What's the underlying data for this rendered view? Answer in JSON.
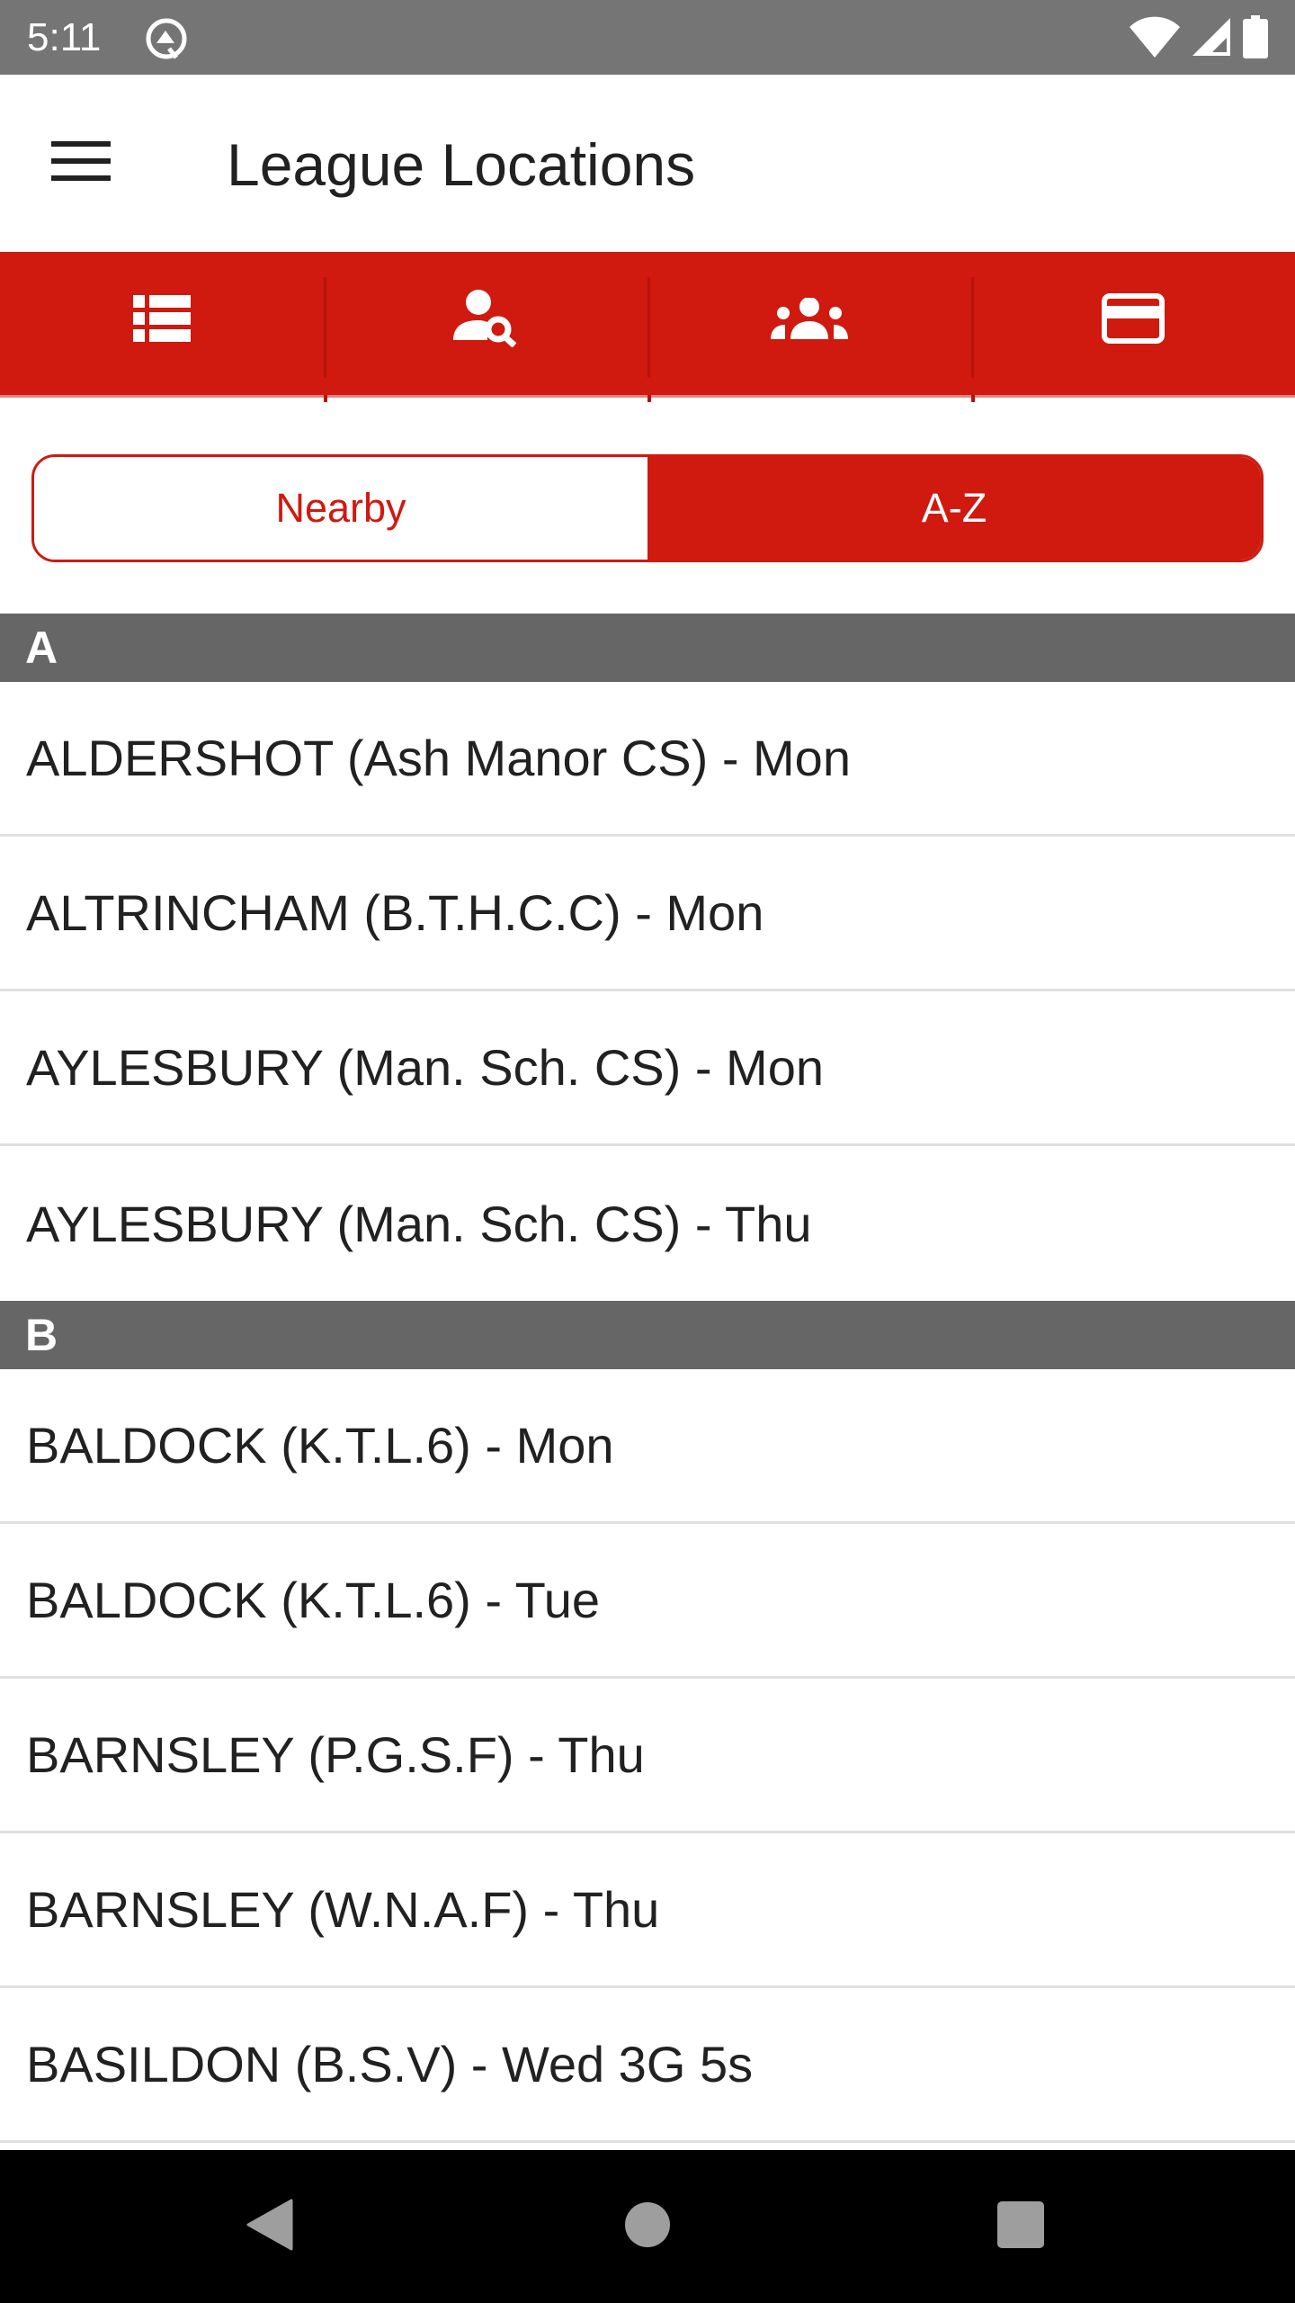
{
  "status_bar": {
    "time": "5:11",
    "icons": [
      "app-notification-icon",
      "wifi-icon",
      "cellular-signal-icon",
      "battery-icon"
    ]
  },
  "header": {
    "menu_icon": "hamburger-menu-icon",
    "title": "League Locations"
  },
  "tabs": [
    {
      "name": "locations-list",
      "icon": "list-icon"
    },
    {
      "name": "find-player",
      "icon": "person-search-icon"
    },
    {
      "name": "teams",
      "icon": "group-icon"
    },
    {
      "name": "payments",
      "icon": "credit-card-icon"
    }
  ],
  "segmented_control": {
    "options": [
      {
        "label": "Nearby",
        "selected": false
      },
      {
        "label": "A-Z",
        "selected": true
      }
    ]
  },
  "sections": [
    {
      "letter": "A",
      "items": [
        "ALDERSHOT (Ash Manor CS) - Mon",
        "ALTRINCHAM (B.T.H.C.C) - Mon",
        "AYLESBURY (Man. Sch. CS) - Mon",
        "AYLESBURY (Man. Sch. CS) - Thu"
      ]
    },
    {
      "letter": "B",
      "items": [
        "BALDOCK (K.T.L.6) - Mon",
        "BALDOCK (K.T.L.6) - Tue",
        "BARNSLEY (P.G.S.F) - Thu",
        "BARNSLEY (W.N.A.F) - Thu",
        "BASILDON (B.S.V) - Wed 3G 5s"
      ]
    }
  ],
  "colors": {
    "brand_red": "#d0190f",
    "section_header_bg": "#666666",
    "status_bar_bg": "#757575",
    "text_primary": "#212121",
    "divider": "#e0e0e0"
  },
  "nav_bar": {
    "buttons": [
      "back-icon",
      "home-icon",
      "recents-icon"
    ]
  }
}
